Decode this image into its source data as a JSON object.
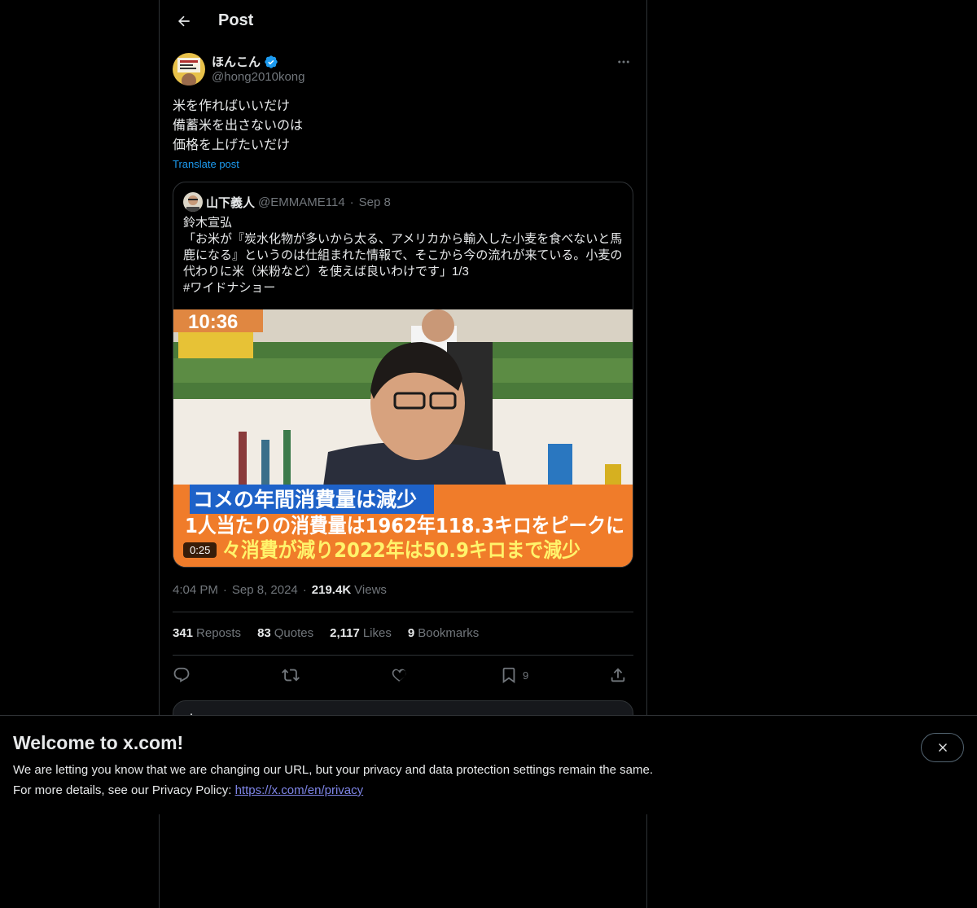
{
  "header": {
    "title": "Post",
    "back_icon": "arrow-left-icon"
  },
  "author": {
    "name": "ほんこん",
    "handle": "@hong2010kong",
    "verified": true,
    "verified_color": "#1d9bf0"
  },
  "post": {
    "text": "米を作ればいいだけ\n備蓄米を出さないのは\n価格を上げたいだけ",
    "translate_label": "Translate post"
  },
  "quote": {
    "name": "山下義人",
    "handle": "@EMMAME114",
    "date": "Sep 8",
    "text": "鈴木宣弘\n「お米が『炭水化物が多いから太る、アメリカから輸入した小麦を食べないと馬鹿になる』というのは仕組まれた情報で、そこから今の流れが来ている。小麦の代わりに米（米粉など）を使えば良いわけです」1/3\n#ワイドナショー",
    "video": {
      "duration": "0:25",
      "clock": "10:36",
      "caption_line1": "コメの年間消費量は減少",
      "caption_line2": "1人当たりの消費量は1962年118.3キロをピークに",
      "caption_line3": "々消費が減り2022年は50.9キロまで減少"
    }
  },
  "meta": {
    "time": "4:04 PM",
    "date": "Sep 8, 2024",
    "views_count": "219.4K",
    "views_label": "Views"
  },
  "stats": [
    {
      "count": "341",
      "label": "Reposts"
    },
    {
      "count": "83",
      "label": "Quotes"
    },
    {
      "count": "2,117",
      "label": "Likes"
    },
    {
      "count": "9",
      "label": "Bookmarks"
    }
  ],
  "actions": {
    "reply_icon": "reply-icon",
    "repost_icon": "repost-icon",
    "like_icon": "heart-icon",
    "bookmark_icon": "bookmark-icon",
    "bookmark_count": "9",
    "share_icon": "share-icon"
  },
  "banner": {
    "title": "Welcome to x.com!",
    "line1": "We are letting you know that we are changing our URL, but your privacy and data protection settings remain the same.",
    "line2_prefix": "For more details, see our Privacy Policy: ",
    "link": "https://x.com/en/privacy",
    "close_icon": "close-icon"
  },
  "colors": {
    "background": "#000000",
    "text": "#e7e9ea",
    "muted": "#71767b",
    "accent": "#1d9bf0",
    "border": "#2f3336",
    "link": "#7f86e8"
  }
}
